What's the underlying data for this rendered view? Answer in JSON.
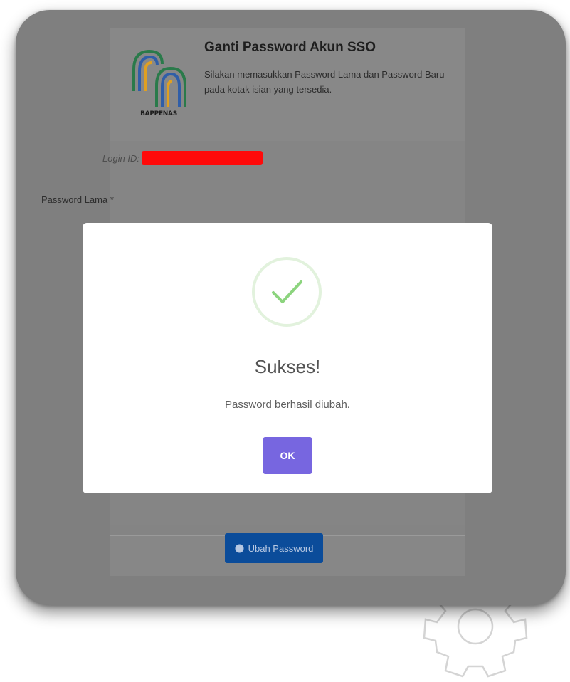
{
  "header": {
    "logo_text": "BAPPENAS",
    "title": "Ganti Password Akun SSO",
    "description": "Silakan memasukkan Password Lama dan Password Baru pada kotak isian yang tersedia."
  },
  "form": {
    "login_label": "Login ID:",
    "password_lama_label": "Password Lama *",
    "submit_label": "Ubah Password"
  },
  "modal": {
    "title": "Sukses!",
    "message": "Password berhasil diubah.",
    "ok_label": "OK"
  },
  "icons": {
    "success": "checkmark-circle-icon",
    "submit": "shield-icon",
    "decoration": "gear-icon"
  },
  "colors": {
    "ok_button": "#7766e0",
    "submit_button": "#0b4c9a",
    "redaction": "#ff0a0a",
    "success_check": "#8cd47e"
  }
}
